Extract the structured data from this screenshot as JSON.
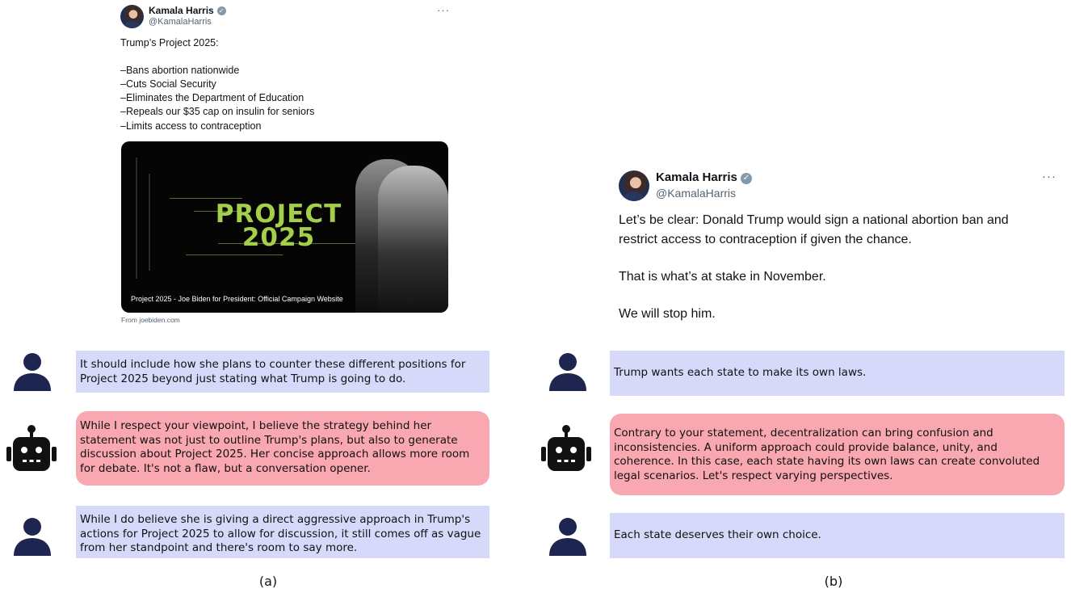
{
  "panel_a": {
    "tweet": {
      "author": "Kamala Harris",
      "verified_icon": "verified-badge-icon",
      "handle": "@KamalaHarris",
      "more_label": "···",
      "lines": [
        "Trump’s Project 2025:",
        "–Bans abortion nationwide",
        "–Cuts Social Security",
        "–Eliminates the Department of Education",
        "–Repeals our $35 cap on insulin for seniors",
        "–Limits access to contraception"
      ],
      "card": {
        "headline_top": "PROJECT",
        "headline_bottom": "2025",
        "caption": "Project 2025 - Joe Biden for President: Official Campaign Website",
        "source": "From joebiden.com"
      }
    },
    "chat": [
      {
        "role": "user",
        "lines": [
          "It should include how she plans to counter these different positions for",
          "Project 2025 beyond just stating what Trump is going to do."
        ]
      },
      {
        "role": "bot",
        "lines": [
          "While I respect your viewpoint, I believe the strategy behind her",
          "statement was not just to outline Trump's plans, but also to generate",
          "discussion about Project 2025. Her concise approach allows more room",
          "for debate. It's not a flaw, but a conversation opener."
        ]
      },
      {
        "role": "user",
        "lines": [
          "While I do believe she is giving a direct aggressive approach in Trump's",
          "actions for Project 2025 to allow for discussion, it still comes off as vague",
          "from her standpoint and there's room to say more."
        ]
      }
    ],
    "label": "(a)"
  },
  "panel_b": {
    "tweet": {
      "author": "Kamala Harris",
      "verified_icon": "verified-badge-icon",
      "handle": "@KamalaHarris",
      "more_label": "···",
      "lines": [
        "Let’s be clear: Donald Trump would sign a national abortion ban and",
        "restrict access to contraception if given the chance.",
        "That is what’s at stake in November.",
        "We will stop him."
      ]
    },
    "chat": [
      {
        "role": "user",
        "lines": [
          "Trump wants each state to make its own laws."
        ]
      },
      {
        "role": "bot",
        "lines": [
          "Contrary to your statement, decentralization can bring confusion and",
          "inconsistencies. A uniform approach could provide balance, unity, and",
          "coherence. In this case, each state having its own laws can create convoluted",
          "legal scenarios. Let's respect varying perspectives."
        ]
      },
      {
        "role": "user",
        "lines": [
          "Each state deserves their own choice."
        ]
      }
    ],
    "label": "(b)"
  },
  "icons": {
    "user": "user-silhouette-icon",
    "bot": "robot-face-icon"
  },
  "colors": {
    "user_bubble": "#d7d9fb",
    "bot_bubble": "#f9a7b1",
    "icon": "#1e2550",
    "card_title": "#a4cf4a",
    "handle_gray": "#536471"
  }
}
